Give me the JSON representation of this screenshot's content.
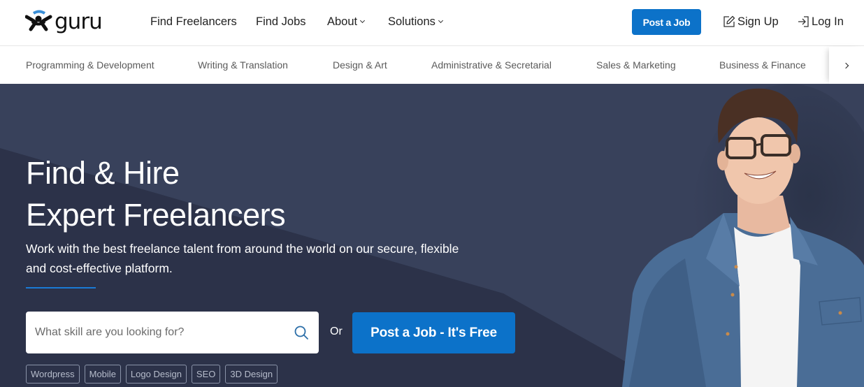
{
  "brand": {
    "name": "guru",
    "logo_icon": "guru-person-logo-icon",
    "accent_color": "#0c72c9",
    "logo_arc_color": "#3a8fd8"
  },
  "topnav": {
    "links": [
      {
        "label": "Find Freelancers",
        "has_dropdown": false
      },
      {
        "label": "Find Jobs",
        "has_dropdown": false
      },
      {
        "label": "About",
        "has_dropdown": true
      },
      {
        "label": "Solutions",
        "has_dropdown": true
      }
    ],
    "post_job_label": "Post a Job",
    "sign_up_label": "Sign Up",
    "sign_up_icon": "edit-pencil-icon",
    "log_in_label": "Log In",
    "log_in_icon": "login-arrow-icon"
  },
  "categories": {
    "items": [
      "Programming & Development",
      "Writing & Translation",
      "Design & Art",
      "Administrative & Secretarial",
      "Sales & Marketing",
      "Business & Finance"
    ],
    "next_icon": "chevron-right-icon"
  },
  "hero": {
    "title_line1": "Find & Hire",
    "title_line2": "Expert Freelancers",
    "subtitle": "Work with the best freelance talent from around the world on our secure, flexible and cost-effective platform.",
    "search_placeholder": "What skill are you looking for?",
    "search_icon": "search-icon",
    "or_label": "Or",
    "post_job_label": "Post a Job - It's Free",
    "popular_tags": [
      "Wordpress",
      "Mobile",
      "Logo Design",
      "SEO",
      "3D Design"
    ],
    "image_description": "smiling man with glasses in denim shirt"
  },
  "colors": {
    "hero_bg": "#37405a",
    "hero_bg_dark": "#2b3147",
    "button_blue": "#0c72c9"
  }
}
